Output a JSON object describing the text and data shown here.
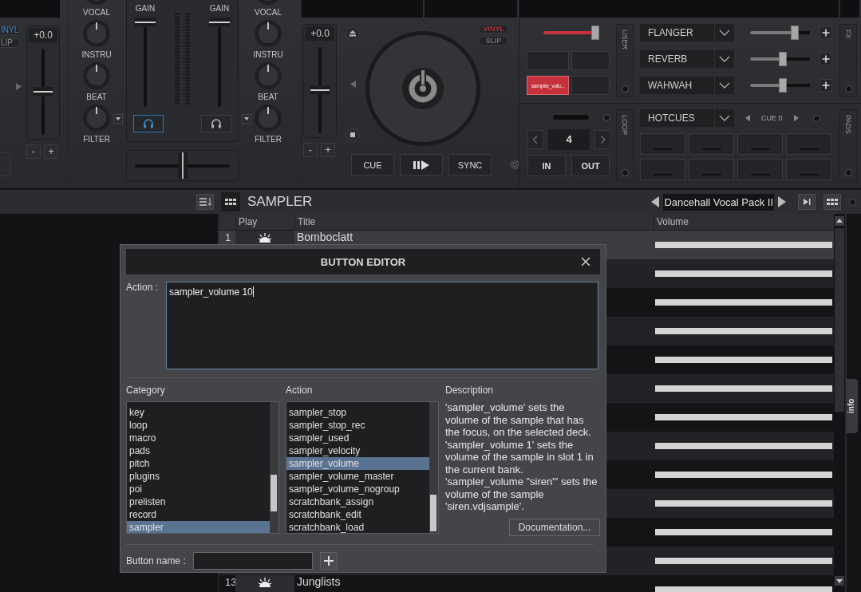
{
  "left_deck": {
    "vinyl": {
      "label": "INYL",
      "on": true
    },
    "slip": {
      "label": "LIP",
      "on": false
    },
    "pitch": {
      "reading": "+0.0",
      "level": 0.5
    },
    "minus": "-",
    "plus": "+"
  },
  "mixer": {
    "left_eq": [
      {
        "label": "VOCAL"
      },
      {
        "label": "INSTRU"
      },
      {
        "label": "BEAT"
      },
      {
        "label": "FILTER"
      }
    ],
    "right_eq": [
      {
        "label": "VOCAL"
      },
      {
        "label": "INSTRU"
      },
      {
        "label": "BEAT"
      },
      {
        "label": "FILTER"
      }
    ],
    "gains": [
      {
        "label": "GAIN",
        "level": 1
      },
      {
        "label": "GAIN",
        "level": 1
      }
    ],
    "headphones": [
      {
        "selected": true
      },
      {
        "selected": false
      }
    ],
    "crossfader": {
      "level": 0.5
    }
  },
  "right_deck": {
    "pitch": {
      "reading": "+0.0",
      "level": 0.5
    },
    "minus": "-",
    "plus": "+",
    "vinyl": {
      "label": "VINYL",
      "on": true
    },
    "slip": {
      "label": "SLIP",
      "on": false
    },
    "cue": "CUE",
    "sync": "SYNC"
  },
  "sampler_pads": {
    "volume": {
      "level": 0.9
    },
    "pads": [
      {
        "active": false
      },
      {
        "active": false
      },
      {
        "active": true,
        "label": "sampler_volu..."
      },
      {
        "active": false
      }
    ],
    "tab": "USER"
  },
  "fx": {
    "slots": [
      {
        "name": "FLANGER",
        "level": 0.75
      },
      {
        "name": "REVERB",
        "level": 0.55
      },
      {
        "name": "WAHWAH",
        "level": 0.55
      }
    ],
    "tab": "FX"
  },
  "loop": {
    "length": "4",
    "in": "IN",
    "out": "OUT",
    "tab": "LOOP"
  },
  "hotcues": {
    "mode": "HOTCUES",
    "cue": "CUE 0",
    "tab": "PADS",
    "pads": [
      {
        "set": false
      },
      {
        "set": false
      },
      {
        "set": false
      },
      {
        "set": false
      },
      {
        "set": false
      },
      {
        "set": false
      },
      {
        "set": false
      },
      {
        "set": false
      }
    ]
  },
  "sampler": {
    "title": "SAMPLER",
    "bank": "Dancehall Vocal Pack II",
    "columns": [
      "Play",
      "Title",
      "Volume"
    ],
    "rows": [
      {
        "number": "1",
        "title": "Bomboclatt",
        "selected": true,
        "level": 1
      },
      {
        "selected": false,
        "level": 1
      },
      {
        "selected": false,
        "level": 1
      },
      {
        "selected": false,
        "level": 1
      },
      {
        "selected": false,
        "level": 1
      },
      {
        "selected": false,
        "level": 1
      },
      {
        "selected": false,
        "level": 1
      },
      {
        "selected": false,
        "level": 1
      },
      {
        "selected": false,
        "level": 1
      },
      {
        "selected": false,
        "level": 1
      },
      {
        "selected": false,
        "level": 1
      },
      {
        "selected": false,
        "level": 1
      },
      {
        "number": "13",
        "title": "Junglists",
        "selected": false,
        "level": 1
      }
    ],
    "info_tab": "info"
  },
  "dialog": {
    "title": "BUTTON EDITOR",
    "action_label": "Action :",
    "action_value": "sampler_volume 10",
    "category_heading": "Category",
    "categories": [
      {
        "label": "key",
        "selected": false
      },
      {
        "label": "loop",
        "selected": false
      },
      {
        "label": "macro",
        "selected": false
      },
      {
        "label": "pads",
        "selected": false
      },
      {
        "label": "pitch",
        "selected": false
      },
      {
        "label": "plugins",
        "selected": false
      },
      {
        "label": "poi",
        "selected": false
      },
      {
        "label": "prelisten",
        "selected": false
      },
      {
        "label": "record",
        "selected": false
      },
      {
        "label": "sampler",
        "selected": true
      }
    ],
    "action_heading": "Action",
    "actions": [
      {
        "label": "sampler_stop",
        "selected": false
      },
      {
        "label": "sampler_stop_rec",
        "selected": false
      },
      {
        "label": "sampler_used",
        "selected": false
      },
      {
        "label": "sampler_velocity",
        "selected": false
      },
      {
        "label": "sampler_volume",
        "selected": true
      },
      {
        "label": "sampler_volume_master",
        "selected": false
      },
      {
        "label": "sampler_volume_nogroup",
        "selected": false
      },
      {
        "label": "scratchbank_assign",
        "selected": false
      },
      {
        "label": "scratchbank_edit",
        "selected": false
      },
      {
        "label": "scratchbank_load",
        "selected": false
      }
    ],
    "description_heading": "Description",
    "description": "'sampler_volume' sets the volume of the sample that has the focus, on the selected deck. 'sampler_volume 1' sets the volume of the sample in slot 1 in the current bank. 'sampler_volume \"siren\"' sets the volume of the sample 'siren.vdjsample'.",
    "doc_button": "Documentation...",
    "name_label": "Button name :"
  }
}
